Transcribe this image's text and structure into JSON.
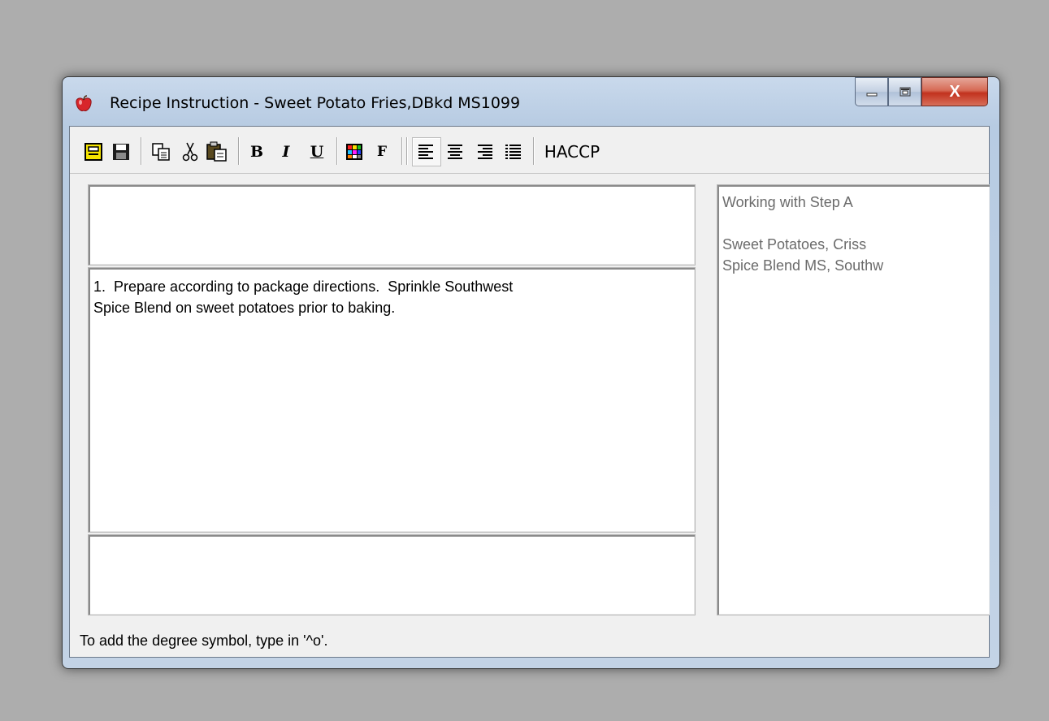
{
  "window": {
    "title": "Recipe Instruction - Sweet Potato Fries,DBkd MS1099",
    "app_icon": "apple-icon",
    "controls": {
      "minimize": "minimize-icon",
      "maximize": "maximize-icon",
      "close": "X"
    }
  },
  "toolbar": {
    "icons": [
      "preview-icon",
      "save-icon",
      "copy-icon",
      "cut-icon",
      "paste-icon",
      "color-icon"
    ],
    "bold": "B",
    "italic": "I",
    "underline": "U",
    "font": "F",
    "align": [
      "align-left-icon",
      "align-center-icon",
      "align-right-icon",
      "justify-icon"
    ],
    "haccp": "HACCP"
  },
  "editor": {
    "header_text": "",
    "body_text": "1.  Prepare according to package directions.  Sprinkle Southwest\nSpice Blend on sweet potatoes prior to baking.",
    "footer_text": ""
  },
  "side_panel": {
    "heading": "Working with Step A",
    "ingredients": [
      "Sweet Potatoes, Criss",
      "Spice Blend MS, Southw"
    ]
  },
  "status": "To add the degree symbol, type in '^o'.",
  "colors": {
    "desktop": "#adadad",
    "window_frame": "#c3d3e6",
    "close_button": "#c2321e"
  }
}
